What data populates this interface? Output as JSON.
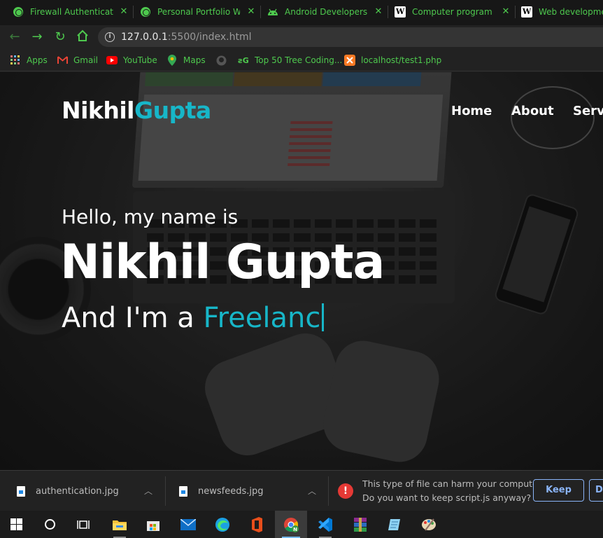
{
  "tabs": [
    {
      "title": "Firewall Authentication",
      "favicon": "globe-icon"
    },
    {
      "title": "Personal Portfolio Website",
      "favicon": "globe-icon"
    },
    {
      "title": "Android Developers",
      "favicon": "android-icon"
    },
    {
      "title": "Computer programming",
      "favicon": "wikipedia-icon"
    },
    {
      "title": "Web development",
      "favicon": "wikipedia-icon"
    }
  ],
  "address_bar": {
    "host": "127.0.0.1",
    "rest": ":5500/index.html"
  },
  "bookmarks": [
    {
      "label": "Apps",
      "icon": "apps-grid-icon"
    },
    {
      "label": "Gmail",
      "icon": "gmail-icon"
    },
    {
      "label": "YouTube",
      "icon": "youtube-icon"
    },
    {
      "label": "Maps",
      "icon": "maps-pin-icon"
    },
    {
      "label": "",
      "icon": "github-icon"
    },
    {
      "label": "Top 50 Tree Coding...",
      "icon": "geeksforgeeks-icon"
    },
    {
      "label": "localhost/test1.php",
      "icon": "xampp-icon"
    }
  ],
  "site": {
    "logo_first": "Nikhil",
    "logo_second": "Gupta",
    "menu": [
      "Home",
      "About",
      "Servi"
    ],
    "hello": "Hello, my name is",
    "name": "Nikhil Gupta",
    "role_prefix": "And I'm a ",
    "role_typed": "Freelanc",
    "accent_color": "#17b6c8"
  },
  "downloads": {
    "items": [
      {
        "filename": "authentication.jpg"
      },
      {
        "filename": "newsfeeds.jpg"
      }
    ],
    "warning_line1": "This type of file can harm your computer.",
    "warning_line2": "Do you want to keep script.js anyway?",
    "keep_label": "Keep",
    "discard_label": "D"
  },
  "taskbar": {
    "items": [
      "windows-start-icon",
      "search-circle-icon",
      "task-view-icon",
      "file-explorer-icon",
      "microsoft-store-icon",
      "mail-icon",
      "edge-icon",
      "office-icon",
      "chrome-icon",
      "vscode-icon",
      "winrar-icon",
      "notepad-icon",
      "paint-icon"
    ]
  }
}
